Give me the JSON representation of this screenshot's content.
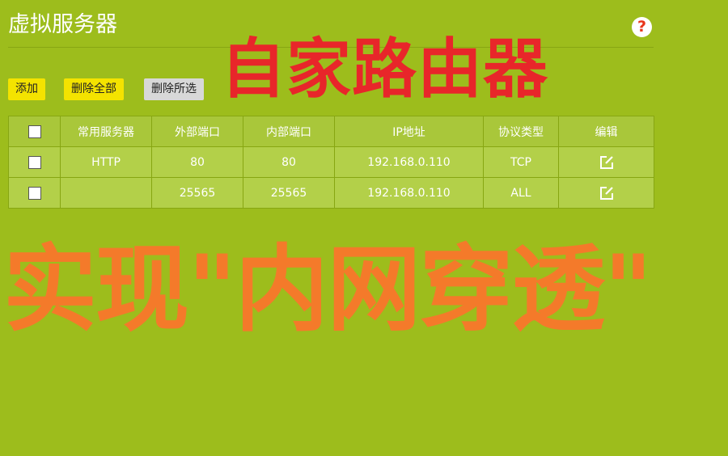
{
  "page": {
    "title": "虚拟服务器",
    "help_icon": "question-mark-icon",
    "help_symbol": "?"
  },
  "toolbar": {
    "add_label": "添加",
    "delete_all_label": "删除全部",
    "delete_selected_label": "删除所选"
  },
  "table": {
    "headers": [
      "常用服务器",
      "外部端口",
      "内部端口",
      "IP地址",
      "协议类型",
      "编辑"
    ],
    "rows": [
      {
        "service": "HTTP",
        "external_port": "80",
        "internal_port": "80",
        "ip": "192.168.0.110",
        "protocol": "TCP",
        "edit_icon": "edit-icon"
      },
      {
        "service": "",
        "external_port": "25565",
        "internal_port": "25565",
        "ip": "192.168.0.110",
        "protocol": "ALL",
        "edit_icon": "edit-icon"
      }
    ]
  },
  "overlay": {
    "line1": "自家路由器",
    "line2": "实现\"内网穿透\""
  },
  "colors": {
    "background": "#9dbd1c",
    "overlay_red": "#e8262a",
    "overlay_orange": "#f47a2a",
    "button_yellow": "#f4e300"
  }
}
